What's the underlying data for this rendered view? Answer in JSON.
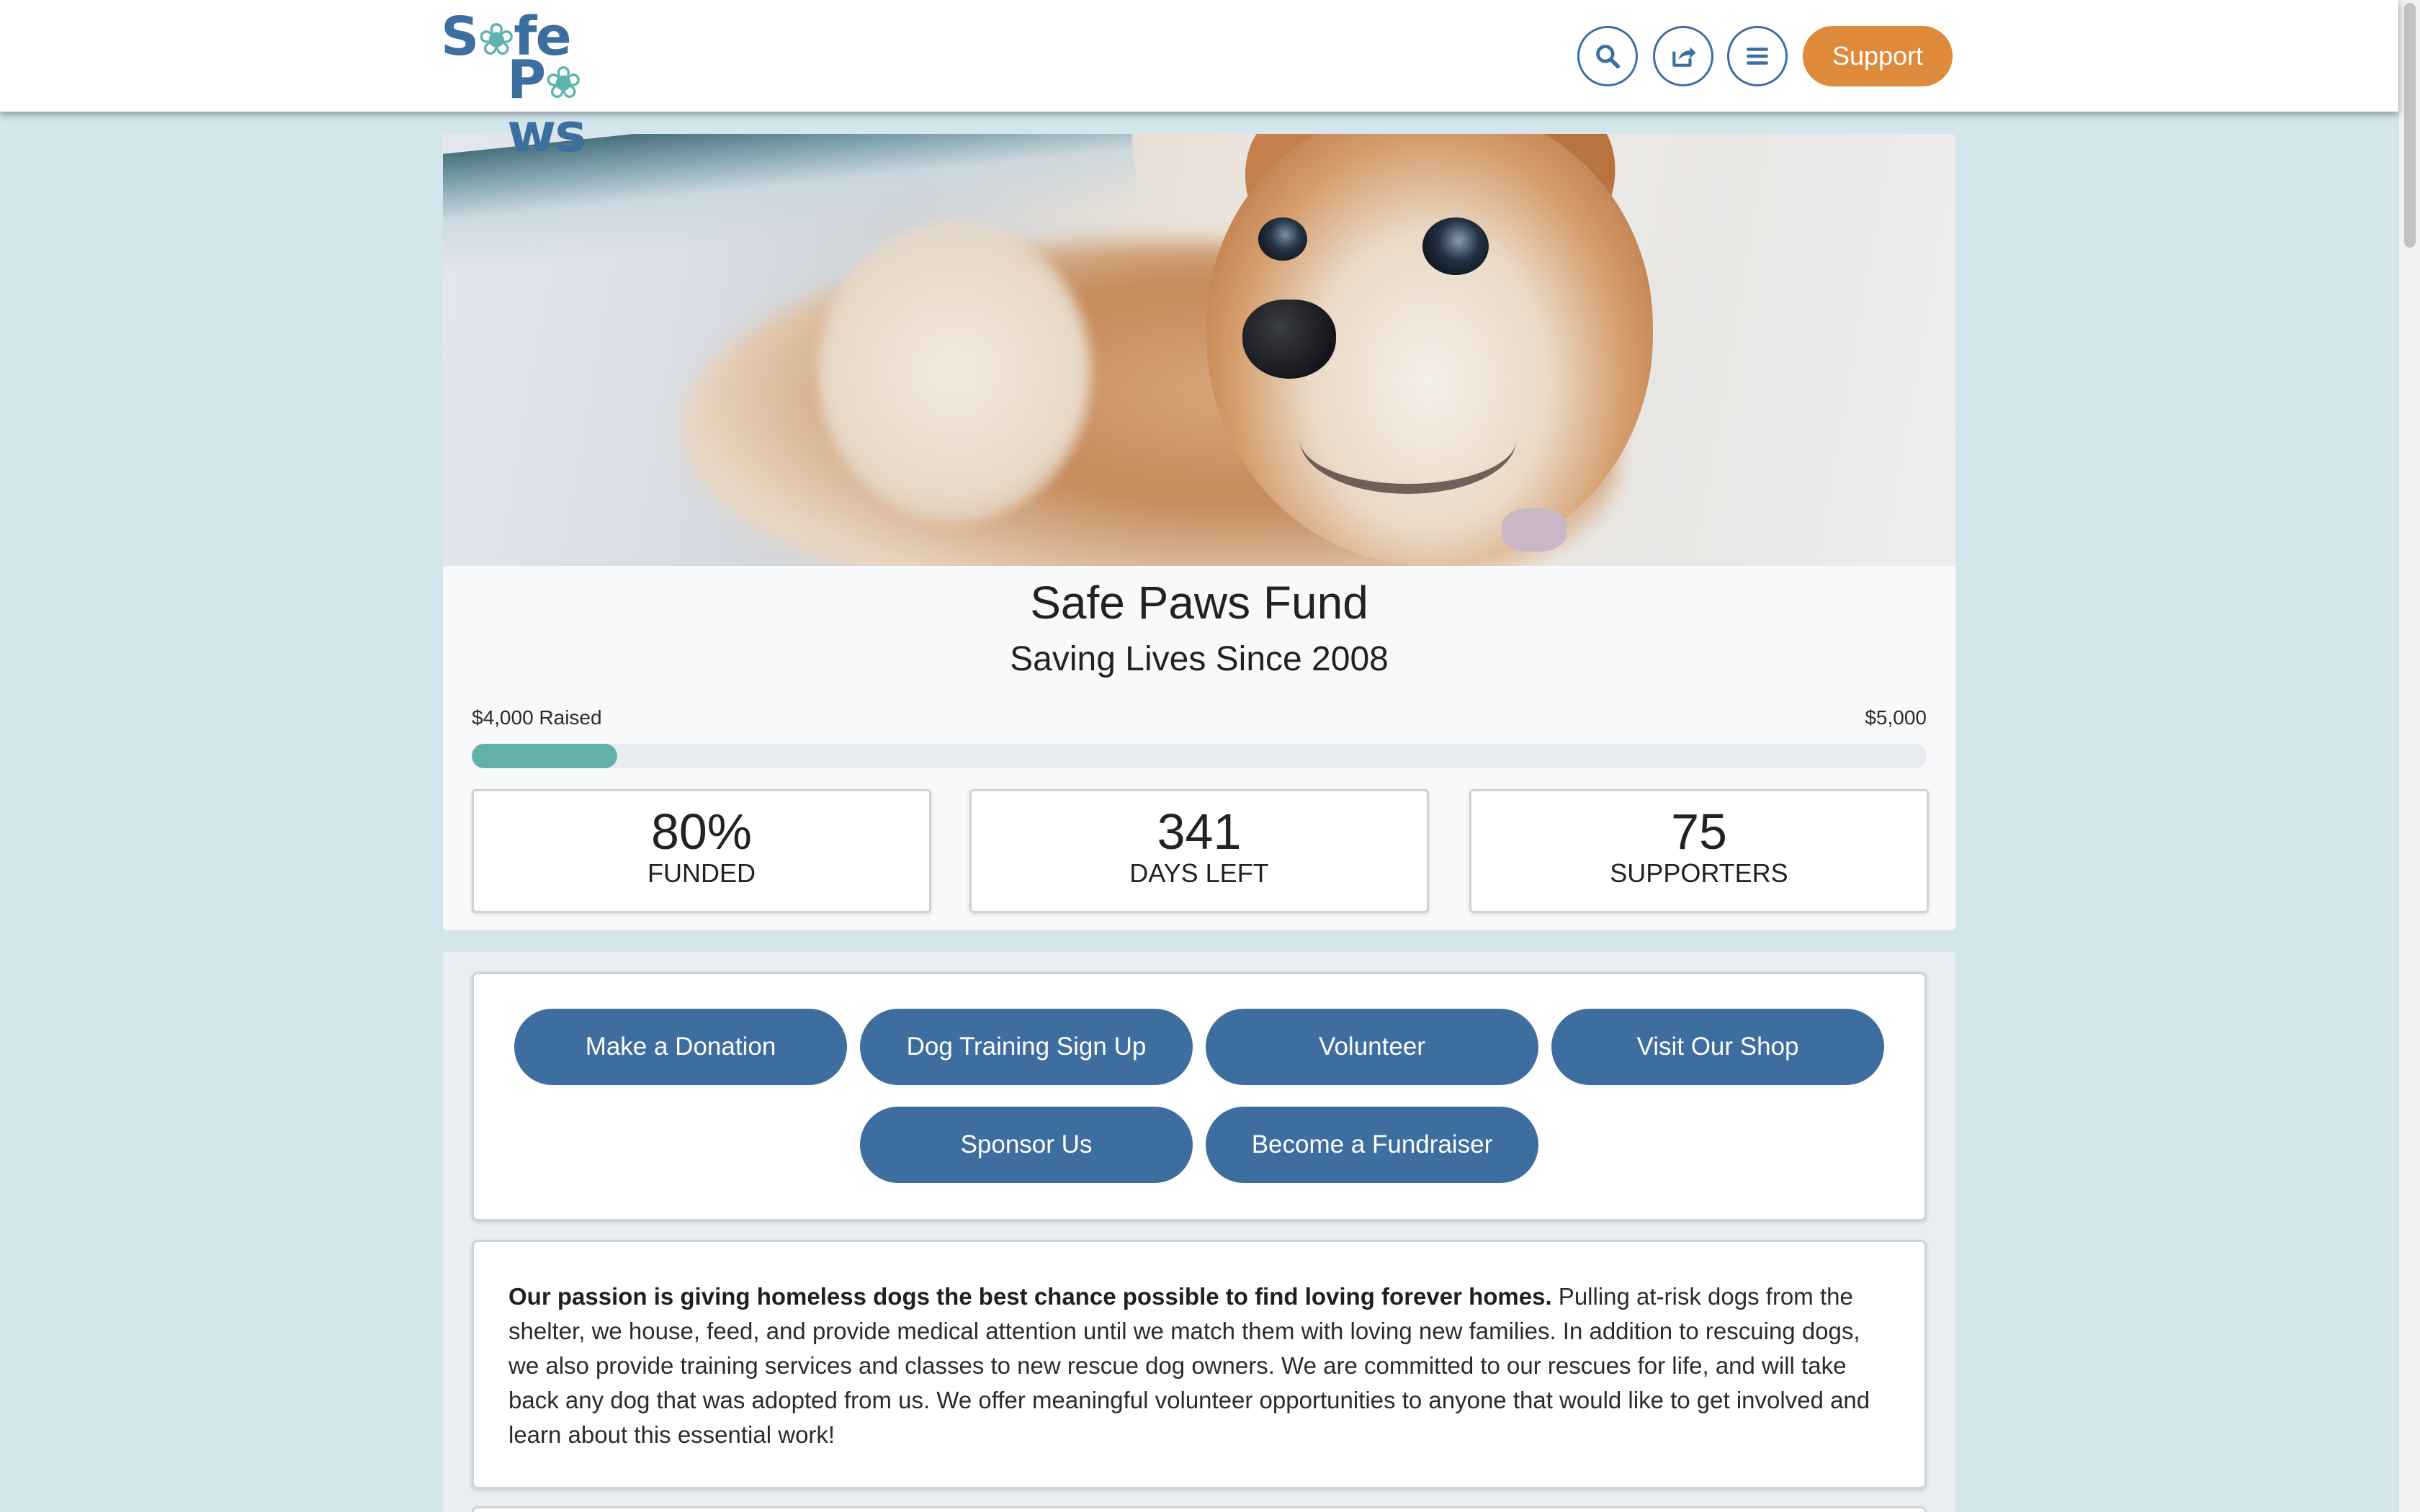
{
  "header": {
    "logo_line1": "Safe",
    "logo_line2": "Paws",
    "support_label": "Support",
    "icons": [
      "search-icon",
      "share-icon",
      "menu-icon"
    ]
  },
  "fund": {
    "title": "Safe Paws Fund",
    "subtitle": "Saving Lives Since 2008",
    "raised_label": "$4,000 Raised",
    "goal_label": "$5,000",
    "progress_fraction": 0.1,
    "stats": [
      {
        "value": "80%",
        "label": "FUNDED"
      },
      {
        "value": "341",
        "label": "DAYS LEFT"
      },
      {
        "value": "75",
        "label": "SUPPORTERS"
      }
    ]
  },
  "actions": [
    "Make a Donation",
    "Dog Training Sign Up",
    "Volunteer",
    "Visit Our Shop",
    "Sponsor Us",
    "Become a Fundraiser"
  ],
  "about": {
    "lead": "Our passion is giving homeless dogs the best chance possible to find loving forever homes.",
    "body": " Pulling at-risk dogs from the shelter, we house, feed, and provide medical attention until we match them with loving new families. In addition to rescuing dogs, we also provide training services and classes to new rescue dog owners. We are committed to our rescues for life, and will take back any dog that was adopted from us. We offer meaningful volunteer opportunities to anyone that would like to get involved and learn about this essential work!"
  },
  "colors": {
    "page_bg": "#d3e6ec",
    "brand_blue": "#3e6e9f",
    "accent_orange": "#de8a3a",
    "progress_teal": "#62b0a8"
  }
}
